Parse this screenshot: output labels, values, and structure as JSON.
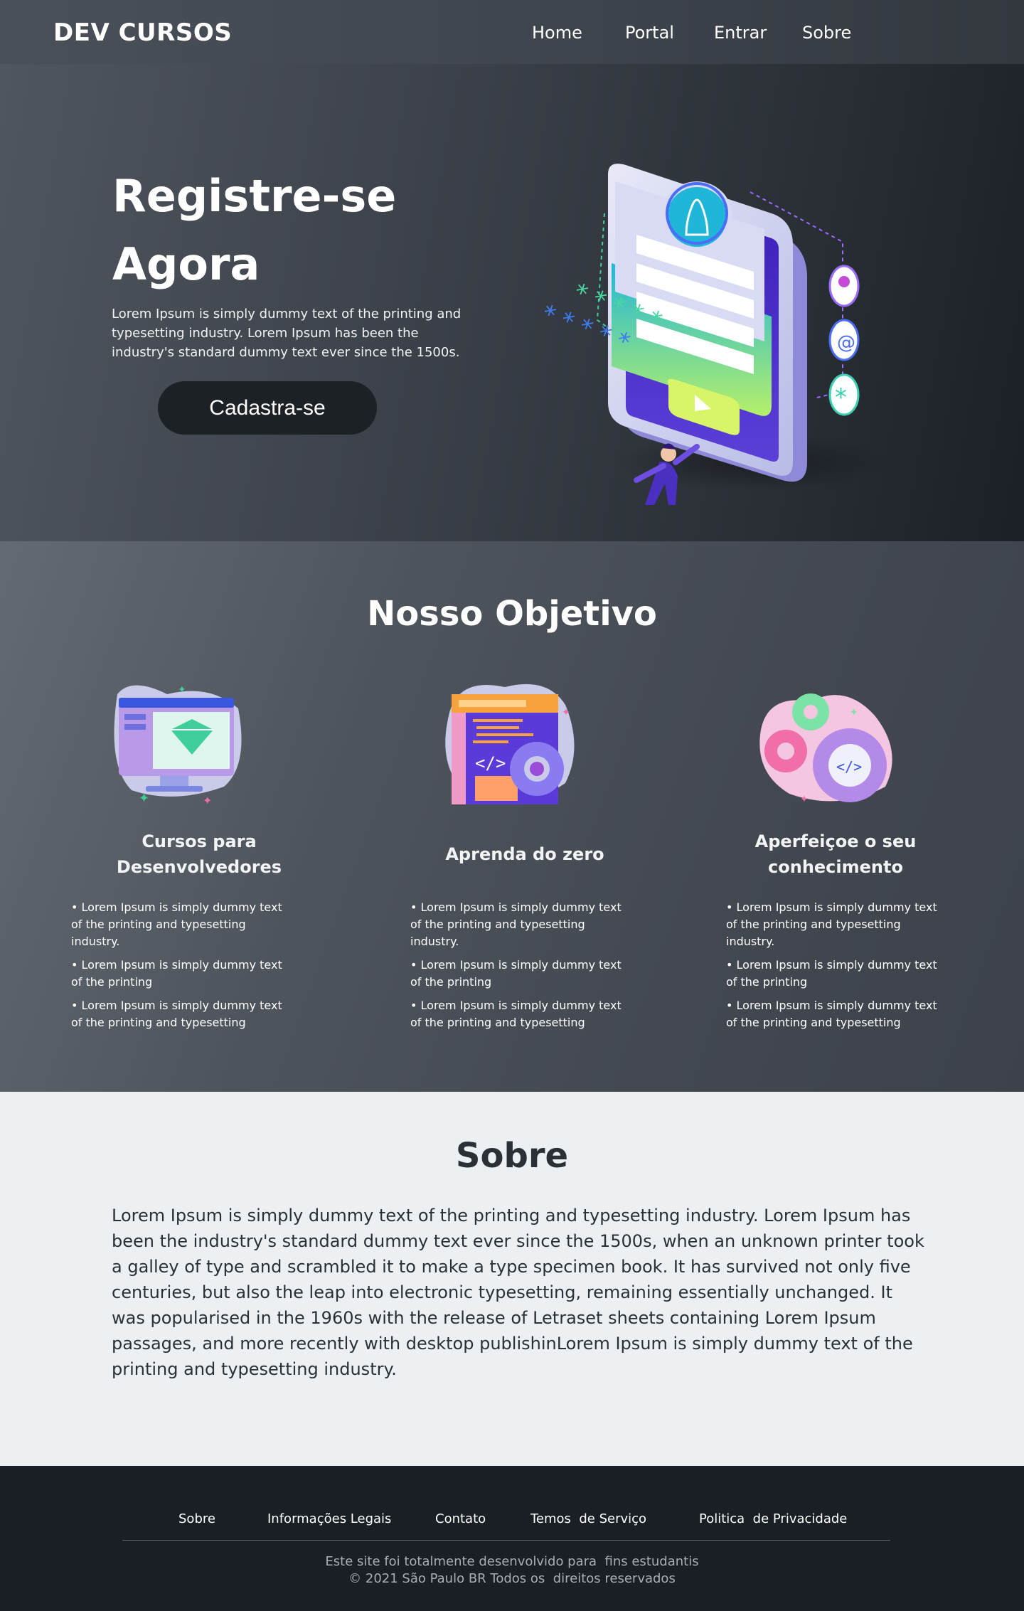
{
  "nav": {
    "brand": "DEV CURSOS",
    "links": [
      "Home",
      "Portal",
      "Entrar",
      "Sobre"
    ]
  },
  "hero": {
    "title_line1": "Registre-se",
    "title_line2": "Agora",
    "text": "Lorem Ipsum is simply dummy text of the printing and typesetting industry. Lorem Ipsum has been the industry's standard dummy text ever since the 1500s.",
    "button": "Cadastra-se"
  },
  "objective": {
    "title": "Nosso Objetivo",
    "cards": [
      {
        "icon": "monitor-diamond-icon",
        "title": "Cursos para Desenvolvedores",
        "bullets": [
          "Lorem Ipsum is simply dummy text of the printing and typesetting industry.",
          "Lorem Ipsum is simply dummy text of the printing",
          "Lorem Ipsum is simply dummy text of the printing and typesetting"
        ]
      },
      {
        "icon": "code-window-gear-icon",
        "title": "Aprenda do zero",
        "bullets": [
          "Lorem Ipsum is simply dummy text of the printing and typesetting industry.",
          "Lorem Ipsum is simply dummy text of the printing",
          "Lorem Ipsum is simply dummy text of the printing and typesetting"
        ]
      },
      {
        "icon": "gears-code-icon",
        "title": "Aperfeiçoe o seu conhecimento",
        "bullets": [
          "Lorem Ipsum is simply dummy text of the printing and typesetting industry.",
          "Lorem Ipsum is simply dummy text of the printing",
          "Lorem Ipsum is simply dummy text of the printing and typesetting"
        ]
      }
    ]
  },
  "about": {
    "title": "Sobre",
    "text": "Lorem Ipsum is simply dummy text of the printing and typesetting industry. Lorem Ipsum has been the industry's standard dummy text ever since the 1500s, when an unknown printer took a galley of type and scrambled it to make a type specimen book. It has survived not only five centuries, but also the leap into electronic typesetting, remaining essentially unchanged. It was popularised in the 1960s with the release of Letraset sheets containing Lorem Ipsum passages, and more recently with desktop publishinLorem Ipsum is simply dummy text of the printing and typesetting industry."
  },
  "footer": {
    "links": [
      "Sobre",
      "Informações Legais",
      "Contato",
      "Temos  de Serviço",
      "Politica  de Privacidade"
    ],
    "line1": "Este site foi totalmente desenvolvido para  fins estudantis",
    "line2": "© 2021 São Paulo BR Todos os  direitos reservados"
  },
  "colors": {
    "dark": "#1c2126",
    "light_bg": "#edf0f2",
    "accent_purple": "#5b3fd6",
    "accent_green": "#b6f06a"
  }
}
